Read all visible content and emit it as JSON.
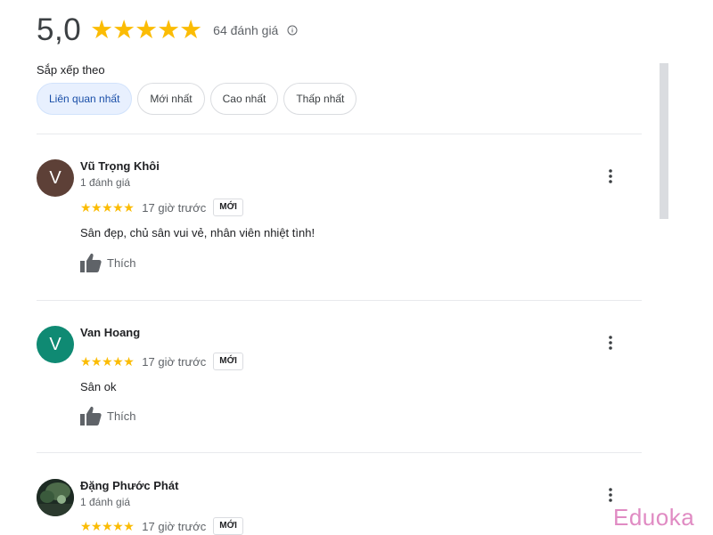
{
  "summary": {
    "score": "5,0",
    "stars": "★★★★★",
    "review_count": "64 đánh giá",
    "info_icon": "info-circle-icon"
  },
  "sort": {
    "label": "Sắp xếp theo",
    "options": [
      "Liên quan nhất",
      "Mới nhất",
      "Cao nhất",
      "Thấp nhất"
    ],
    "selected": "Liên quan nhất"
  },
  "reviews": [
    {
      "avatar_letter": "V",
      "avatar_color": "#5d4037",
      "name": "Vũ Trọng Khôi",
      "review_count": "1 đánh giá",
      "rating": 5,
      "stars": "★★★★★",
      "time": "17 giờ trước",
      "badge": "MỚI",
      "text": "Sân đẹp, chủ sân vui vẻ, nhân viên nhiệt tình!",
      "like_label": "Thích"
    },
    {
      "avatar_letter": "V",
      "avatar_color": "#0f8a73",
      "name": "Van Hoang",
      "rating": 5,
      "stars": "★★★★★",
      "time": "17 giờ trước",
      "badge": "MỚI",
      "text": "Sân ok",
      "like_label": "Thích"
    },
    {
      "avatar_type": "photo",
      "name": "Đặng Phước Phát",
      "review_count": "1 đánh giá",
      "rating": 5,
      "stars": "★★★★★",
      "time": "17 giờ trước",
      "badge": "MỚI"
    }
  ],
  "watermark": "Eduoka",
  "colors": {
    "star": "#fbbc04",
    "chip_active_bg": "#e8f0fe",
    "watermark": "#e08bc3"
  }
}
